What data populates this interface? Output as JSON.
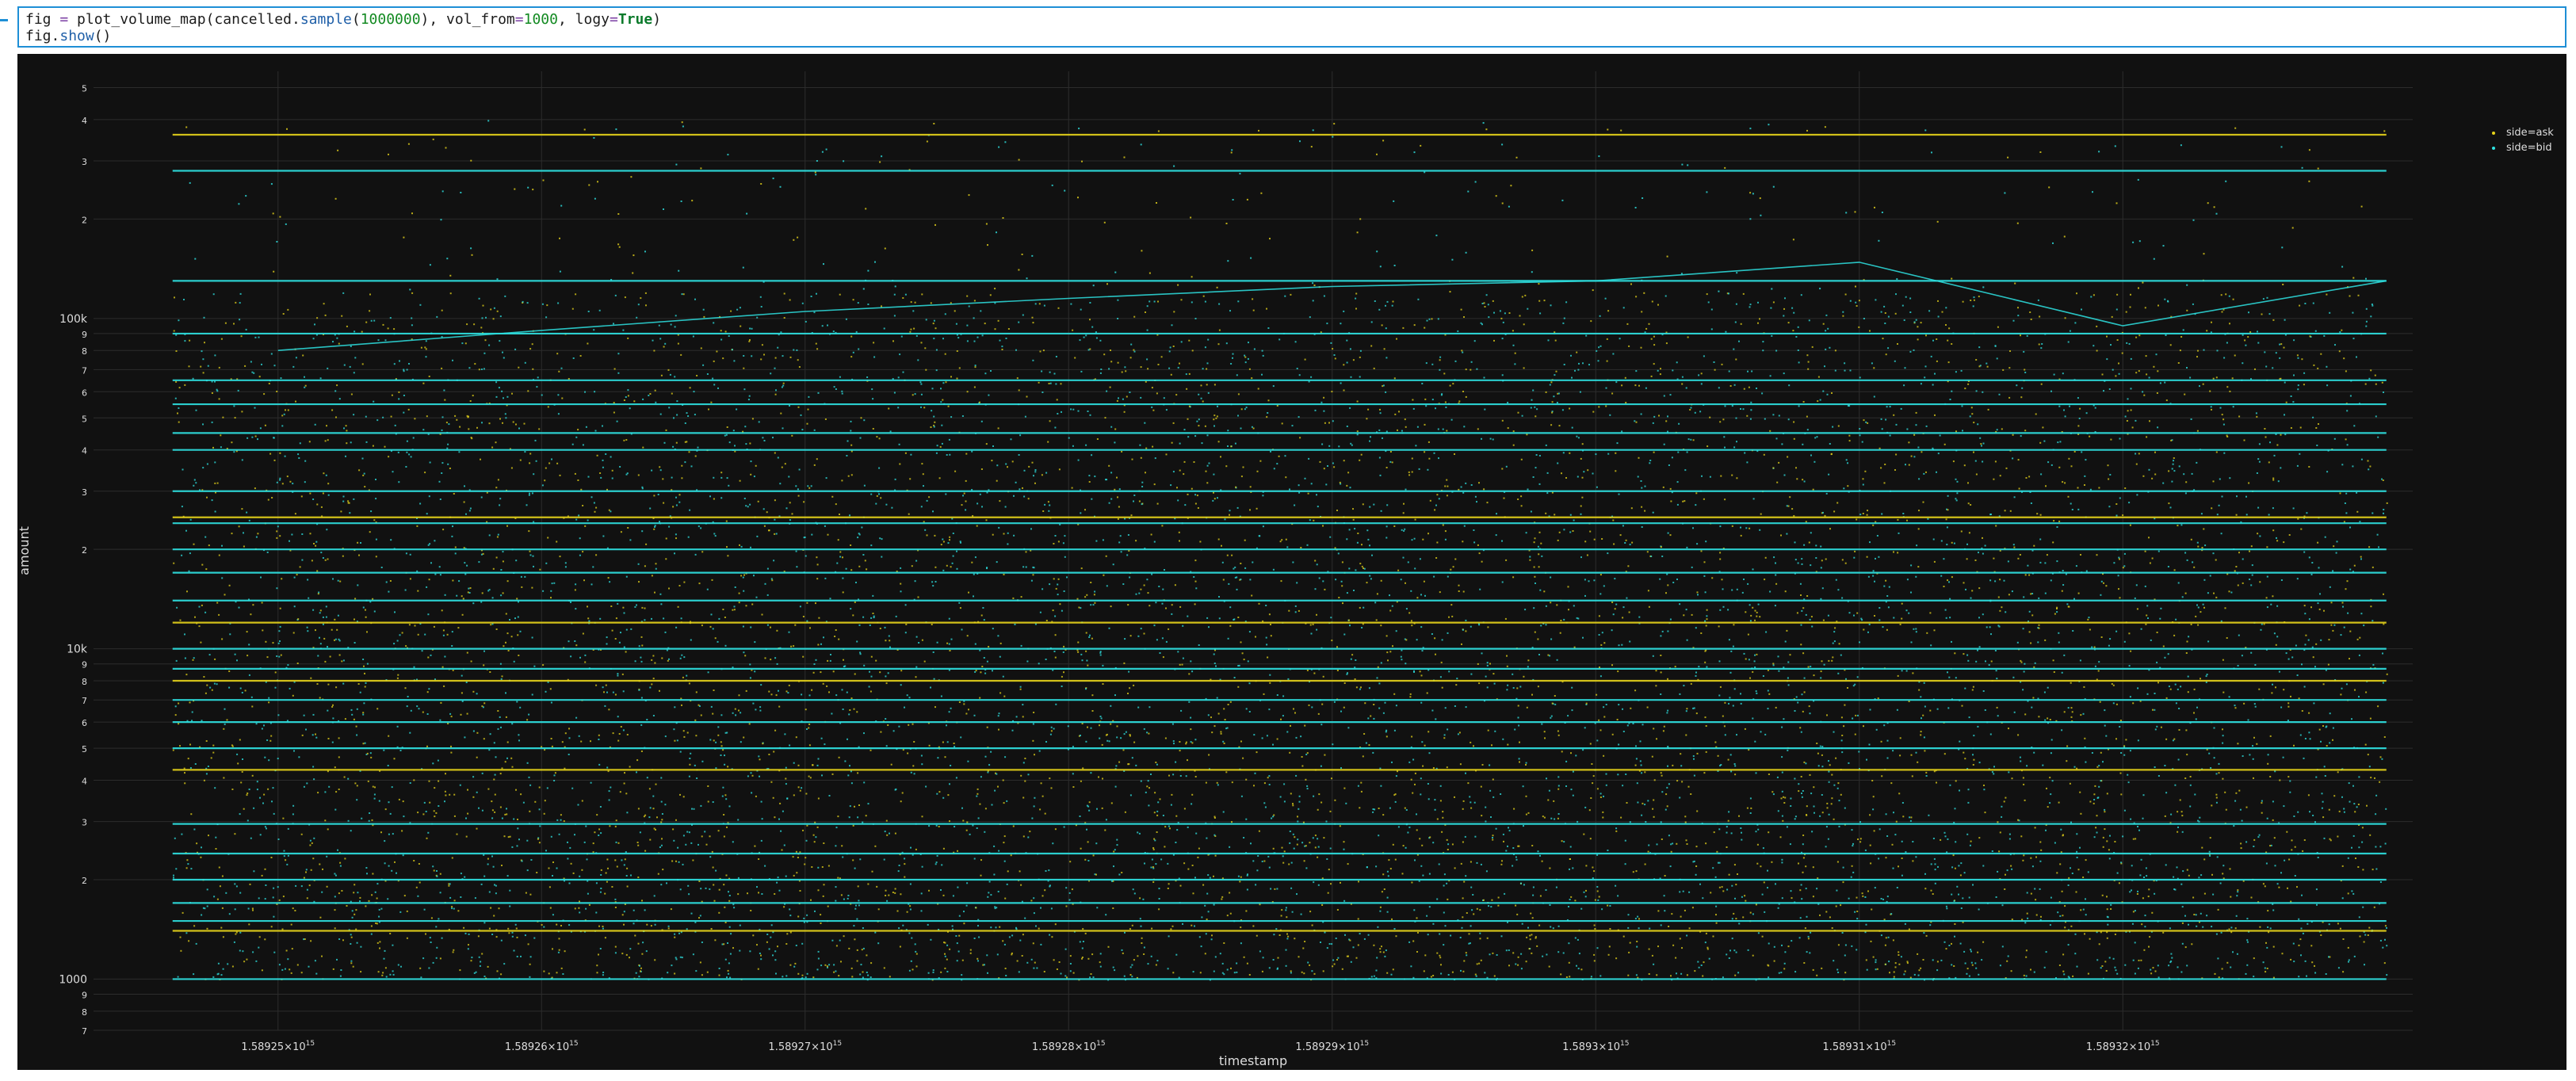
{
  "notebook": {
    "code_lines": [
      [
        {
          "t": "fig ",
          "c": ""
        },
        {
          "t": "=",
          "c": "c-op"
        },
        {
          "t": " plot_volume_map(cancelled.",
          "c": ""
        },
        {
          "t": "sample",
          "c": "c-func"
        },
        {
          "t": "(",
          "c": ""
        },
        {
          "t": "1000000",
          "c": "c-num"
        },
        {
          "t": "), vol_from",
          "c": ""
        },
        {
          "t": "=",
          "c": "c-op"
        },
        {
          "t": "1000",
          "c": "c-num"
        },
        {
          "t": ", logy",
          "c": ""
        },
        {
          "t": "=",
          "c": "c-op"
        },
        {
          "t": "True",
          "c": "c-kw"
        },
        {
          "t": ")",
          "c": ""
        }
      ],
      [
        {
          "t": "fig.",
          "c": ""
        },
        {
          "t": "show",
          "c": "c-func"
        },
        {
          "t": "()",
          "c": ""
        }
      ]
    ]
  },
  "chart_data": {
    "type": "scatter",
    "xlabel": "timestamp",
    "ylabel": "amount",
    "log_y": true,
    "grid": true,
    "legend_position": "top-right",
    "background": "#111111",
    "xlim": [
      1589243000000000.0,
      1589331000000000.0
    ],
    "ylim": [
      700,
      560000
    ],
    "x_ticks": [
      {
        "value": 1589250000000000.0,
        "label": "1.58925×10",
        "exp": "15"
      },
      {
        "value": 1589260000000000.0,
        "label": "1.58926×10",
        "exp": "15"
      },
      {
        "value": 1589270000000000.0,
        "label": "1.58927×10",
        "exp": "15"
      },
      {
        "value": 1589280000000000.0,
        "label": "1.58928×10",
        "exp": "15"
      },
      {
        "value": 1589290000000000.0,
        "label": "1.58929×10",
        "exp": "15"
      },
      {
        "value": 1589300000000000.0,
        "label": "1.5893×10",
        "exp": "15"
      },
      {
        "value": 1589310000000000.0,
        "label": "1.58931×10",
        "exp": "15"
      },
      {
        "value": 1589320000000000.0,
        "label": "1.58932×10",
        "exp": "15"
      }
    ],
    "y_ticks": [
      {
        "value": 700,
        "label": "7"
      },
      {
        "value": 800,
        "label": "8"
      },
      {
        "value": 900,
        "label": "9"
      },
      {
        "value": 1000,
        "label": "1000"
      },
      {
        "value": 2000,
        "label": "2"
      },
      {
        "value": 3000,
        "label": "3"
      },
      {
        "value": 4000,
        "label": "4"
      },
      {
        "value": 5000,
        "label": "5"
      },
      {
        "value": 6000,
        "label": "6"
      },
      {
        "value": 7000,
        "label": "7"
      },
      {
        "value": 8000,
        "label": "8"
      },
      {
        "value": 9000,
        "label": "9"
      },
      {
        "value": 10000,
        "label": "10k"
      },
      {
        "value": 20000,
        "label": "2"
      },
      {
        "value": 30000,
        "label": "3"
      },
      {
        "value": 40000,
        "label": "4"
      },
      {
        "value": 50000,
        "label": "5"
      },
      {
        "value": 60000,
        "label": "6"
      },
      {
        "value": 70000,
        "label": "7"
      },
      {
        "value": 80000,
        "label": "8"
      },
      {
        "value": 90000,
        "label": "9"
      },
      {
        "value": 100000,
        "label": "100k"
      },
      {
        "value": 200000,
        "label": "2"
      },
      {
        "value": 300000,
        "label": "3"
      },
      {
        "value": 400000,
        "label": "4"
      },
      {
        "value": 500000,
        "label": "5"
      }
    ],
    "series": [
      {
        "name": "side=ask",
        "color": "#e6d31a"
      },
      {
        "name": "side=bid",
        "color": "#2ee3e3"
      }
    ],
    "horizontal_levels": [
      {
        "y": 1000,
        "series": 1
      },
      {
        "y": 1400,
        "series": 0
      },
      {
        "y": 1500,
        "series": 1
      },
      {
        "y": 1700,
        "series": 1
      },
      {
        "y": 2000,
        "series": 1
      },
      {
        "y": 2400,
        "series": 1
      },
      {
        "y": 2950,
        "series": 1
      },
      {
        "y": 4300,
        "series": 0
      },
      {
        "y": 5000,
        "series": 1
      },
      {
        "y": 6000,
        "series": 1
      },
      {
        "y": 7000,
        "series": 1
      },
      {
        "y": 8000,
        "series": 0
      },
      {
        "y": 8700,
        "series": 1
      },
      {
        "y": 10000,
        "series": 1
      },
      {
        "y": 12000,
        "series": 0
      },
      {
        "y": 14000,
        "series": 1
      },
      {
        "y": 17000,
        "series": 1
      },
      {
        "y": 20000,
        "series": 1
      },
      {
        "y": 24000,
        "series": 1
      },
      {
        "y": 25000,
        "series": 0
      },
      {
        "y": 30000,
        "series": 1
      },
      {
        "y": 40000,
        "series": 1
      },
      {
        "y": 45000,
        "series": 1
      },
      {
        "y": 55000,
        "series": 1
      },
      {
        "y": 65000,
        "series": 1
      },
      {
        "y": 90000,
        "series": 1
      },
      {
        "y": 130000,
        "series": 1
      },
      {
        "y": 280000,
        "series": 1
      },
      {
        "y": 360000,
        "series": 0
      }
    ],
    "price_path": [
      [
        1589250000000000.0,
        80000
      ],
      [
        1589260000000000.0,
        92000
      ],
      [
        1589270000000000.0,
        105000
      ],
      [
        1589280000000000.0,
        115000
      ],
      [
        1589290000000000.0,
        125000
      ],
      [
        1589300000000000.0,
        130000
      ],
      [
        1589310000000000.0,
        148000
      ],
      [
        1589320000000000.0,
        95000
      ],
      [
        1589330000000000.0,
        130000
      ]
    ]
  }
}
